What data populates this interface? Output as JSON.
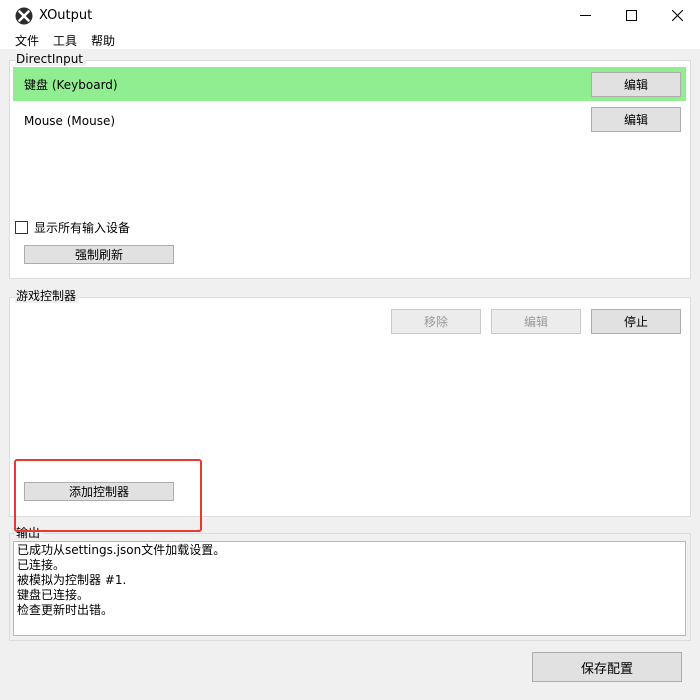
{
  "window": {
    "title": "XOutput",
    "icon": "xoutput-logo-icon",
    "controls": {
      "minimize": "minimize-icon",
      "maximize": "maximize-icon",
      "close": "close-icon"
    }
  },
  "menu": {
    "items": [
      "文件",
      "工具",
      "帮助"
    ]
  },
  "directinput": {
    "label": "DirectInput",
    "devices": [
      {
        "name": "键盘 (Keyboard)",
        "button": "编辑",
        "highlighted": true,
        "highlight_color": "#90ee90"
      },
      {
        "name": "Mouse (Mouse)",
        "button": "编辑",
        "highlighted": false
      }
    ],
    "show_all_label": "显示所有输入设备",
    "show_all_checked": false,
    "refresh_label": "强制刷新"
  },
  "controllers": {
    "label": "游戏控制器",
    "remove_label": "移除",
    "edit_label": "编辑",
    "stop_label": "停止",
    "add_label": "添加控制器",
    "annotation_color": "#e53935"
  },
  "output": {
    "label": "输出",
    "lines": [
      "已成功从settings.json文件加载设置。",
      "已连接。",
      "被模拟为控制器 #1.",
      "键盘已连接。",
      "检查更新时出错。"
    ]
  },
  "footer": {
    "save_label": "保存配置"
  }
}
